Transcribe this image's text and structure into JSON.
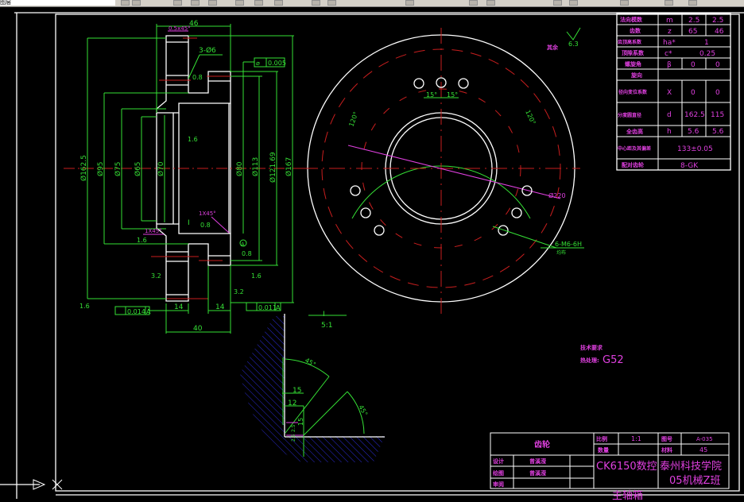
{
  "toolbar": {
    "layer_field": "图层"
  },
  "colors": {
    "dimension": "#35e035",
    "text": "#e040e0",
    "outline": "#ffffff",
    "centerline": "#c81e1e",
    "hatch": "#2a2ad0",
    "background": "#000000"
  },
  "side_view": {
    "dim_width_top": "46",
    "chamfer_top": "0.5x45°",
    "holes_note": "3-Ø6",
    "runout_tol": "0.005",
    "roughness_1": "1.6",
    "roughness_2": "3.2",
    "roughness_3": "0.8",
    "roughness_4": "1.6",
    "roughness_5": "0.8",
    "roughness_6": "1.6",
    "roughness_7": "3.2",
    "roughness_8": "0.8",
    "roughness_9": "1.6",
    "diameters": [
      "Ø162.5",
      "Ø95",
      "Ø75",
      "Ø65",
      "Ø70",
      "Ø80",
      "Ø113",
      "Ø121.69",
      "Ø167"
    ],
    "chamfer_1": "1X45°",
    "chamfer_2": "1X45°",
    "detail_mark": "I",
    "datum": "A",
    "runout_left": "0.014",
    "runout_left_datum": "A",
    "runout_right": "0.011",
    "runout_right_datum": "A",
    "dim_14_left": "14",
    "dim_14_right": "14",
    "dim_40": "40"
  },
  "front_view": {
    "angle_left": "15°",
    "angle_right": "15°",
    "arc_left": "120°",
    "arc_right": "120°",
    "diameter": "Ø220",
    "thread_note": "6-M6-6H",
    "thread_sub": "均布",
    "roughness_other_label": "其余",
    "roughness_other": "6.3"
  },
  "detail_view": {
    "label": "I",
    "scale": "5:1",
    "angle_1": "45°",
    "angle_2": "45°",
    "dim_15a": "15",
    "dim_12": "12",
    "dim_15b": "15",
    "dim_small_1": "2.5",
    "dim_small_2": "2.5"
  },
  "notes": {
    "title": "技术要求",
    "heat_label": "热处理:",
    "heat_value": "G52"
  },
  "param_table": {
    "rows": [
      {
        "label": "法向模数",
        "symbol": "m",
        "v1": "2.5",
        "v2": "2.5"
      },
      {
        "label": "齿数",
        "symbol": "z",
        "v1": "65",
        "v2": "46"
      },
      {
        "label": "齿顶高系数",
        "symbol": "ha*",
        "v": "1"
      },
      {
        "label": "顶隙系数",
        "symbol": "c*",
        "v": "0.25"
      },
      {
        "label": "螺旋角",
        "symbol": "β",
        "v1": "0",
        "v2": "0"
      },
      {
        "label": "旋向",
        "symbol": ""
      },
      {
        "label": "径向变位系数",
        "symbol": "X",
        "v1": "0",
        "v2": "0"
      },
      {
        "label": "分度圆直径",
        "symbol": "d",
        "v1": "162.5",
        "v2": "115"
      },
      {
        "label": "全齿高",
        "symbol": "h",
        "v1": "5.6",
        "v2": "5.6"
      },
      {
        "label": "中心距及其偏差",
        "v": "133±0.05"
      },
      {
        "label": "配对齿轮",
        "v": "8-GK"
      }
    ]
  },
  "title_block": {
    "part_name": "齿轮",
    "scale_label": "比例",
    "scale_value": "1:1",
    "drawing_no_label": "图号",
    "drawing_no": "A-035",
    "qty_label": "数量",
    "qty_value": "",
    "material_label": "材料",
    "material": "45",
    "design_label": "设计",
    "design_name": "曾溪滢",
    "drawn_label": "绘图",
    "drawn_name": "曾溪滢",
    "review_label": "审阅",
    "machine": "CK6150数控",
    "machine_2": "主轴箱",
    "school": "泰州科技学院",
    "class": "05机械Z班"
  }
}
